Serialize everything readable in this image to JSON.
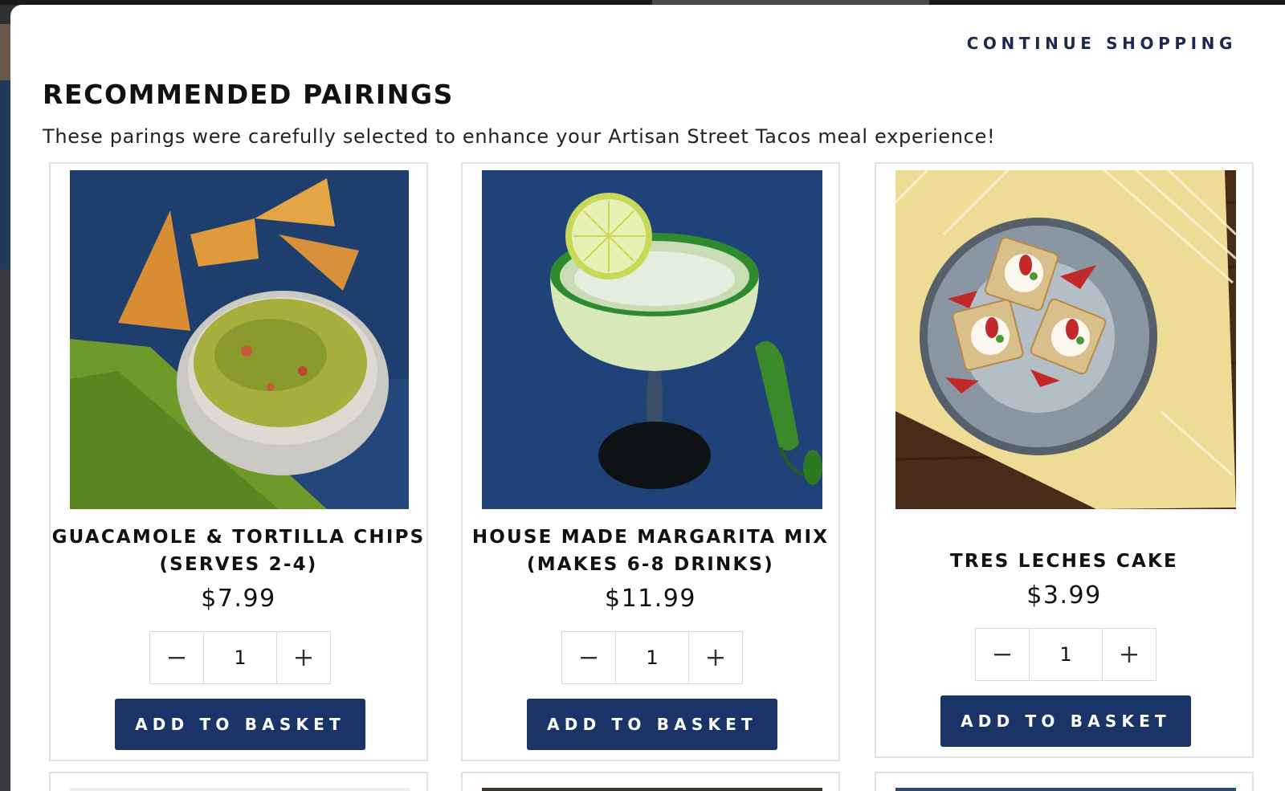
{
  "header": {
    "continue_label": "CONTINUE SHOPPING",
    "title": "RECOMMENDED PAIRINGS",
    "subtitle": "These parings were carefully selected to enhance your Artisan Street Tacos meal experience!"
  },
  "products": [
    {
      "name_line1": "GUACAMOLE & TORTILLA CHIPS",
      "name_line2": "(SERVES 2-4)",
      "price": "$7.99",
      "quantity": "1",
      "add_label": "ADD TO BASKET",
      "image": "guacamole-chips-photo"
    },
    {
      "name_line1": "HOUSE MADE MARGARITA MIX",
      "name_line2": "(MAKES 6-8 DRINKS)",
      "price": "$11.99",
      "quantity": "1",
      "add_label": "ADD TO BASKET",
      "image": "margarita-photo"
    },
    {
      "name_line1": "TRES LECHES CAKE",
      "price": "$3.99",
      "quantity": "1",
      "add_label": "ADD TO BASKET",
      "image": "tres-leches-cake-photo"
    }
  ],
  "stepper": {
    "minus_icon": "minus-icon",
    "plus_icon": "plus-icon"
  },
  "colors": {
    "accent": "#1b3468",
    "text_dark": "#111111",
    "link": "#1b2a4e",
    "border": "#e2e2e2"
  }
}
